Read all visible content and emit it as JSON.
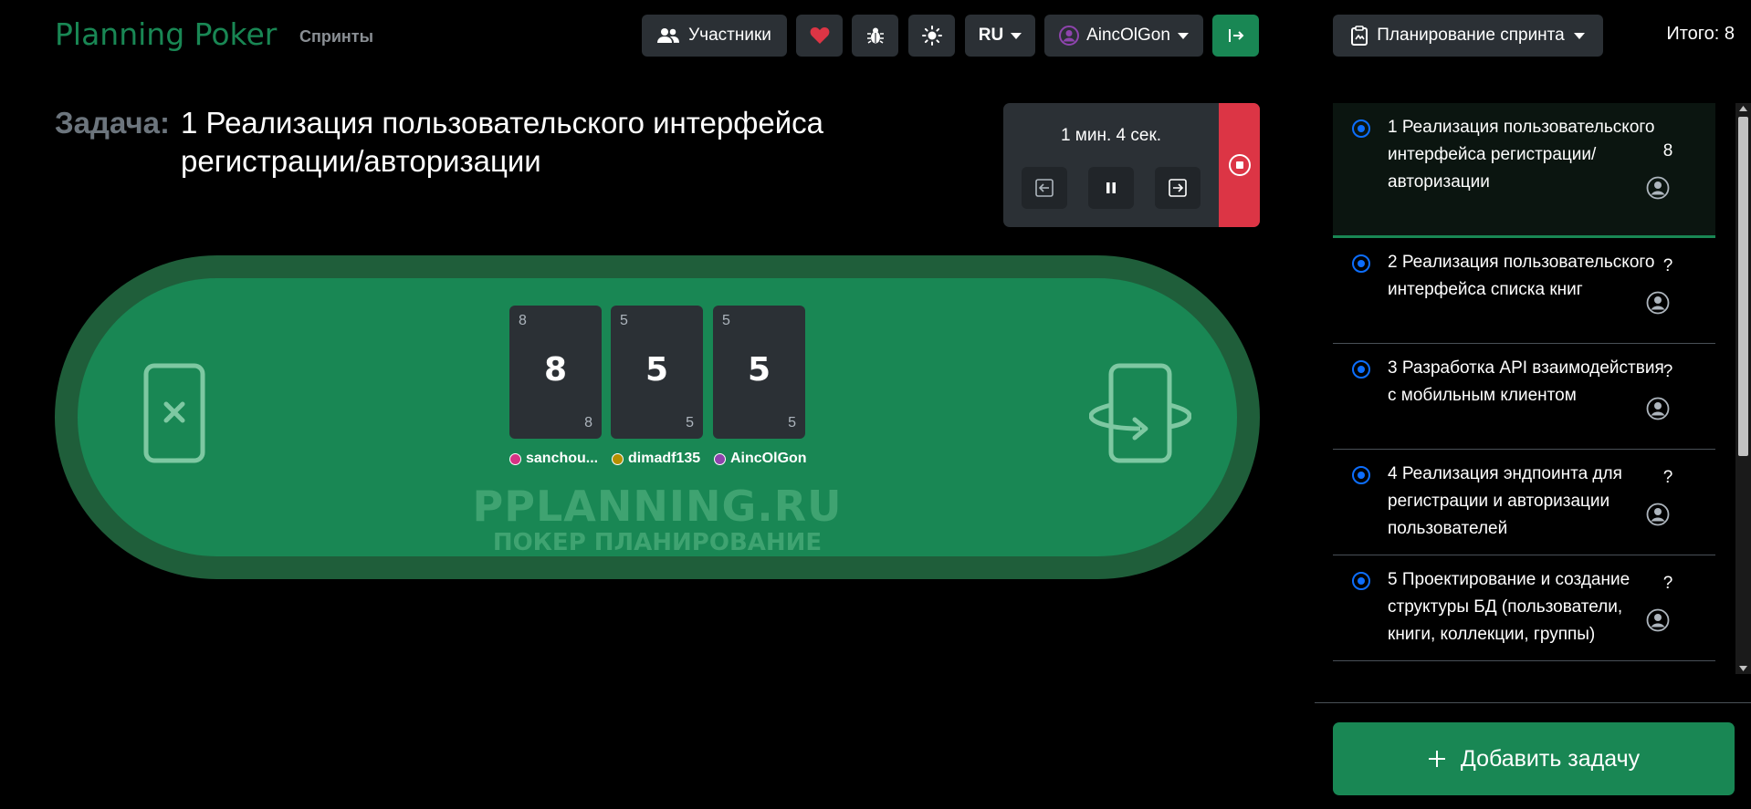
{
  "header": {
    "brand": "Planning Poker",
    "nav_sprints": "Спринты",
    "participants_label": "Участники",
    "lang_label": "RU",
    "user_label": "AincOlGon",
    "sprint_menu_label": "Планирование спринта",
    "total_label": "Итого: 8"
  },
  "task": {
    "label": "Задача:",
    "title": "1 Реализация пользовательского интерфейса регистрации/авторизации"
  },
  "timer": {
    "text": "1 мин. 4 сек."
  },
  "table": {
    "watermark_line1": "PPLANNING.RU",
    "watermark_line2": "ПОКЕР ПЛАНИРОВАНИЕ",
    "cards": [
      {
        "value": "8",
        "player": "sanchou...",
        "color": "#d63384"
      },
      {
        "value": "5",
        "player": "dimadf135",
        "color": "#b58f00"
      },
      {
        "value": "5",
        "player": "AincOlGon",
        "color": "#8e44ad"
      }
    ]
  },
  "tasks": [
    {
      "title": "1 Реализация пользовательского интерфейса регистрации/ авторизации",
      "estimate": "8"
    },
    {
      "title": "2 Реализация пользовательского интерфейса списка книг",
      "estimate": "?"
    },
    {
      "title": "3 Разработка API взаимодействия с мобильным клиентом",
      "estimate": "?"
    },
    {
      "title": "4 Реализация эндпоинта для регистрации и авторизации пользователей",
      "estimate": "?"
    },
    {
      "title": "5 Проектирование и создание структуры БД (пользователи, книги, коллекции, группы)",
      "estimate": "?"
    }
  ],
  "add_task_label": "Добавить задачу",
  "colors": {
    "accent": "#198754",
    "danger": "#dc3545",
    "radio": "#0d6efd"
  }
}
